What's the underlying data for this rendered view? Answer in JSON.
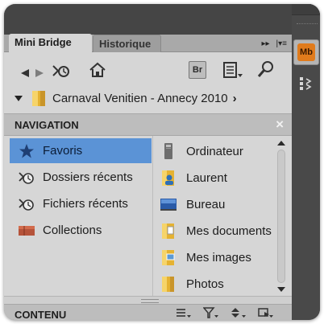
{
  "tabs": [
    {
      "label": "Mini Bridge",
      "active": true
    },
    {
      "label": "Historique",
      "active": false
    }
  ],
  "path": {
    "label": "Carnaval Venitien - Annecy 2010"
  },
  "navigation": {
    "title": "NAVIGATION",
    "close": "×",
    "items": [
      {
        "label": "Favoris",
        "icon": "star-icon",
        "selected": true
      },
      {
        "label": "Dossiers récents",
        "icon": "recent-folders-icon",
        "selected": false
      },
      {
        "label": "Fichiers récents",
        "icon": "recent-files-icon",
        "selected": false
      },
      {
        "label": "Collections",
        "icon": "collections-icon",
        "selected": false
      }
    ],
    "locations": [
      {
        "label": "Ordinateur",
        "icon": "computer-icon"
      },
      {
        "label": "Laurent",
        "icon": "user-folder-icon"
      },
      {
        "label": "Bureau",
        "icon": "desktop-icon"
      },
      {
        "label": "Mes documents",
        "icon": "documents-folder-icon"
      },
      {
        "label": "Mes images",
        "icon": "pictures-folder-icon"
      },
      {
        "label": "Photos",
        "icon": "folder-icon"
      }
    ]
  },
  "content": {
    "title": "CONTENU"
  },
  "toolbar": {
    "bridge_label": "Br"
  },
  "dock": {
    "minibridge_label": "Mb"
  },
  "colors": {
    "selection": "#5b93d6",
    "accent": "#e07b1c",
    "panel": "#d6d6d6"
  }
}
